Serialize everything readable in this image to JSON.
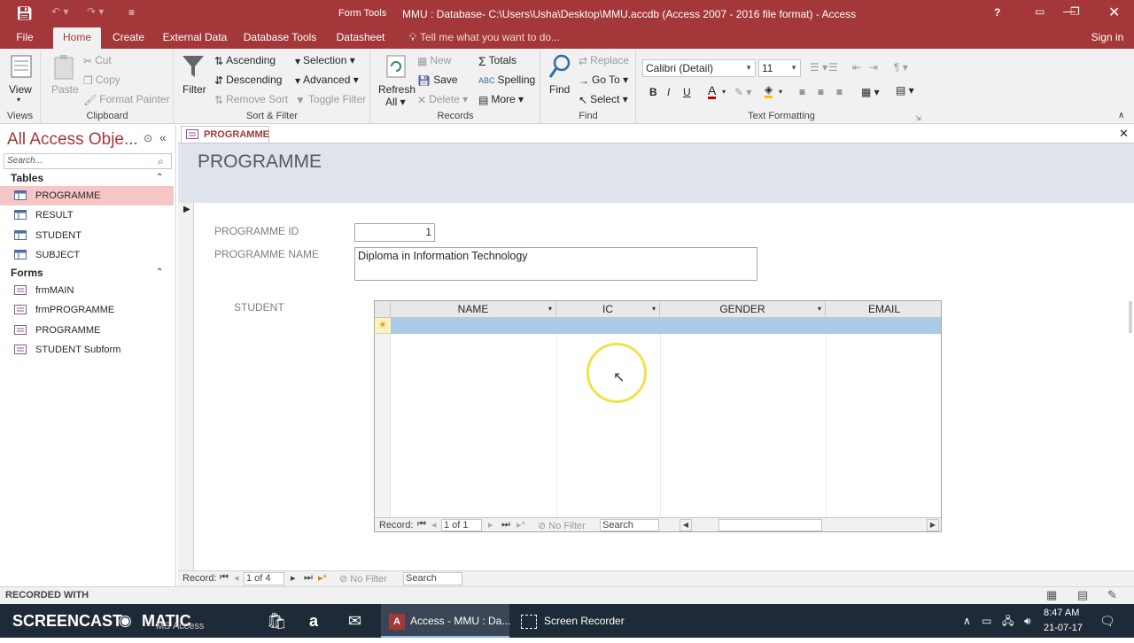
{
  "window": {
    "title": "MMU : Database- C:\\Users\\Usha\\Desktop\\MMU.accdb (Access 2007 - 2016 file format) - Access",
    "context_label": "Form Tools",
    "help": "?",
    "signin": "Sign in"
  },
  "tabs": {
    "file": "File",
    "home": "Home",
    "create": "Create",
    "external": "External Data",
    "dbtools": "Database Tools",
    "datasheet": "Datasheet",
    "tell": "Tell me what you want to do..."
  },
  "ribbon": {
    "views": {
      "view": "View",
      "label": "Views"
    },
    "clipboard": {
      "paste": "Paste",
      "cut": "Cut",
      "copy": "Copy",
      "painter": "Format Painter",
      "label": "Clipboard"
    },
    "sort": {
      "filter": "Filter",
      "ascending": "Ascending",
      "descending": "Descending",
      "remove": "Remove Sort",
      "selection": "Selection",
      "advanced": "Advanced",
      "toggle": "Toggle Filter",
      "label": "Sort & Filter"
    },
    "records": {
      "refresh": "Refresh",
      "all": "All",
      "new": "New",
      "save": "Save",
      "delete": "Delete",
      "totals": "Totals",
      "spelling": "Spelling",
      "more": "More",
      "label": "Records"
    },
    "find": {
      "find": "Find",
      "replace": "Replace",
      "goto": "Go To",
      "select": "Select",
      "label": "Find"
    },
    "text": {
      "font": "Calibri (Detail)",
      "size": "11",
      "bold": "B",
      "italic": "I",
      "underline": "U",
      "fontcolor": "A",
      "label": "Text Formatting"
    }
  },
  "nav": {
    "title": "All Access Obje...",
    "search": "Search...",
    "tables_header": "Tables",
    "forms_header": "Forms",
    "tables": [
      "PROGRAMME",
      "RESULT",
      "STUDENT",
      "SUBJECT"
    ],
    "forms": [
      "frmMAIN",
      "frmPROGRAMME",
      "PROGRAMME",
      "STUDENT Subform"
    ]
  },
  "doc": {
    "tab": "PROGRAMME",
    "header": "PROGRAMME",
    "id_label": "PROGRAMME ID",
    "id_value": "1",
    "name_label": "PROGRAMME NAME",
    "name_value": "Diploma in Information Technology",
    "student_label": "STUDENT"
  },
  "subgrid": {
    "columns": [
      "NAME",
      "IC",
      "GENDER",
      "EMAIL"
    ],
    "new_marker": "✳",
    "rec_label": "Record:",
    "rec_pos": "1 of 1",
    "nofilter": "No Filter",
    "search": "Search"
  },
  "formrec": {
    "rec_label": "Record:",
    "rec_pos": "1 of 4",
    "nofilter": "No Filter",
    "search": "Search"
  },
  "status": {
    "watermark": "RECORDED WITH"
  },
  "taskbar": {
    "logo": "SCREENCAST",
    "logo2": "MATIC",
    "ms": "MS Access",
    "access": "Access - MMU : Da...",
    "recorder": "Screen Recorder",
    "time": "8:47 AM",
    "date": "21-07-17"
  },
  "colors": {
    "accent": "#a4373a",
    "selected_row": "#a9cbe8",
    "nav_selected": "#f6c6c6",
    "header_band": "#dfe3ec"
  }
}
